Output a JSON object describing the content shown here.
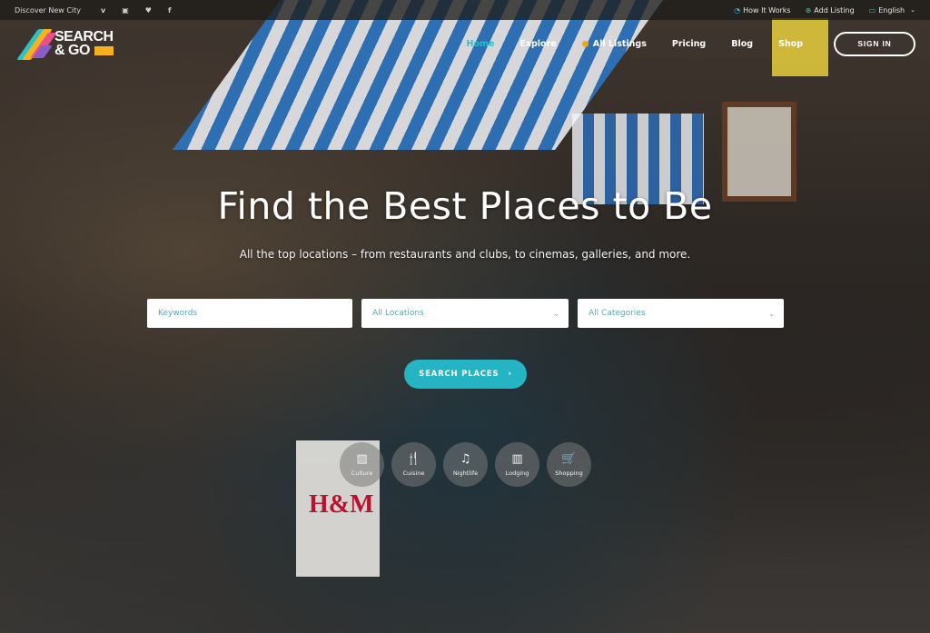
{
  "topbar": {
    "tagline": "Discover New City",
    "social": [
      {
        "name": "vimeo-icon",
        "glyph": "v"
      },
      {
        "name": "instagram-icon",
        "glyph": "▣"
      },
      {
        "name": "twitter-icon",
        "glyph": "♥"
      },
      {
        "name": "facebook-icon",
        "glyph": "f"
      }
    ],
    "links": [
      {
        "label": "How It Works",
        "icon": "◔"
      },
      {
        "label": "Add Listing",
        "icon": "⊕"
      },
      {
        "label": "English",
        "icon": "▭",
        "chevron": "⌄"
      }
    ]
  },
  "logo": {
    "line1": "SEARCH",
    "line2": "& GO"
  },
  "nav": {
    "items": [
      {
        "label": "Home",
        "active": true
      },
      {
        "label": "Explore"
      },
      {
        "label": "All Listings"
      },
      {
        "label": "Pricing"
      },
      {
        "label": "Blog"
      },
      {
        "label": "Shop"
      }
    ],
    "signin_label": "SIGN IN"
  },
  "hero": {
    "title": "Find the Best Places to Be",
    "subtitle": "All the top locations – from restaurants and clubs, to cinemas, galleries, and more."
  },
  "search": {
    "keywords_placeholder": "Keywords",
    "location_value": "All Locations",
    "category_value": "All Categories",
    "button_label": "SEARCH PLACES",
    "button_arrow": "›",
    "chevron": "⌄"
  },
  "categories": [
    {
      "label": "Culture",
      "icon": "▨"
    },
    {
      "label": "Cuisine",
      "icon": "🍴"
    },
    {
      "label": "Nightlife",
      "icon": "♫"
    },
    {
      "label": "Lodging",
      "icon": "▥"
    },
    {
      "label": "Shopping",
      "icon": "🛒"
    }
  ],
  "photo": {
    "bag_text": "H&M"
  },
  "colors": {
    "accent": "#25b4c4",
    "logo_yellow": "#f5b21e",
    "logo_pink": "#ea4f8c",
    "logo_teal": "#29c3c4"
  }
}
